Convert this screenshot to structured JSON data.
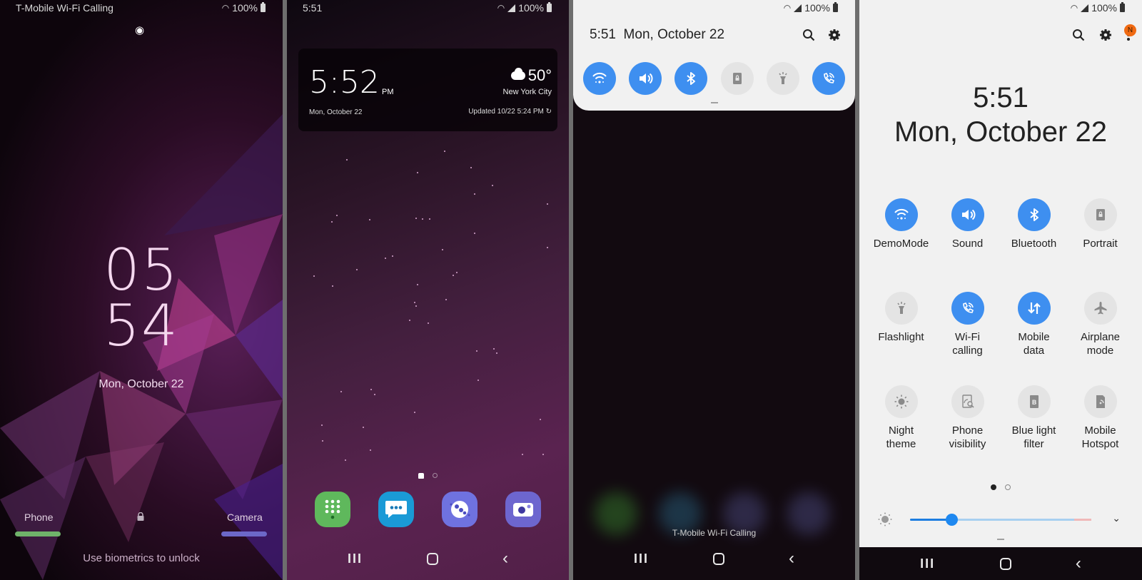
{
  "panel_lockscreen": {
    "status": {
      "carrier": "T-Mobile Wi-Fi Calling",
      "battery": "100%"
    },
    "clock": {
      "hour": "05",
      "minute": "54"
    },
    "date": "Mon, October 22",
    "shortcuts": {
      "left_label": "Phone",
      "right_label": "Camera",
      "left_color": "#6fb36a",
      "right_color": "#6c68c8"
    },
    "hint": "Use biometrics to unlock",
    "icons": {
      "visibility": "eye-icon",
      "lock": "lock-icon"
    }
  },
  "panel_home": {
    "status": {
      "time": "5:51",
      "battery": "100%"
    },
    "widget": {
      "time": "5:52",
      "ampm": "PM",
      "date": "Mon, October 22",
      "temperature": "50°",
      "weather_icon": "cloud-icon",
      "city": "New York City",
      "updated": "Updated 10/22 5:24 PM"
    },
    "page_indicator": {
      "current": 1,
      "total": 2
    },
    "dock": [
      {
        "name": "Phone",
        "icon": "dialpad-icon",
        "color": "#5fb85c"
      },
      {
        "name": "Messages",
        "icon": "message-bubble-icon",
        "color": "#1a9ad6"
      },
      {
        "name": "Samsung Internet",
        "icon": "planet-icon",
        "color": "#6f72e0"
      },
      {
        "name": "Camera",
        "icon": "camera-icon",
        "color": "#6d66cf"
      }
    ]
  },
  "panel_quick_panel": {
    "status": {
      "battery": "100%"
    },
    "header": {
      "time": "5:51",
      "date": "Mon, October 22"
    },
    "tiles": [
      {
        "name": "Wi-Fi",
        "icon": "wifi-icon",
        "on": true
      },
      {
        "name": "Sound",
        "icon": "volume-icon",
        "on": true
      },
      {
        "name": "Bluetooth",
        "icon": "bluetooth-icon",
        "on": true
      },
      {
        "name": "Portrait",
        "icon": "rotation-lock-icon",
        "on": false
      },
      {
        "name": "Flashlight",
        "icon": "flashlight-icon",
        "on": false
      },
      {
        "name": "Wi-Fi calling",
        "icon": "wifi-calling-icon",
        "on": true
      }
    ],
    "carrier": "T-Mobile Wi-Fi Calling"
  },
  "panel_expanded": {
    "status": {
      "battery": "100%"
    },
    "time": "5:51",
    "date": "Mon, October 22",
    "notification_badge": "N",
    "tiles": [
      {
        "label": "DemoMode",
        "icon": "wifi-icon",
        "on": true
      },
      {
        "label": "Sound",
        "icon": "volume-icon",
        "on": true
      },
      {
        "label": "Bluetooth",
        "icon": "bluetooth-icon",
        "on": true
      },
      {
        "label": "Portrait",
        "icon": "rotation-lock-icon",
        "on": false
      },
      {
        "label": "Flashlight",
        "icon": "flashlight-icon",
        "on": false
      },
      {
        "label": "Wi-Fi\ncalling",
        "icon": "wifi-calling-icon",
        "on": true
      },
      {
        "label": "Mobile\ndata",
        "icon": "mobile-data-icon",
        "on": true
      },
      {
        "label": "Airplane\nmode",
        "icon": "airplane-icon",
        "on": false
      },
      {
        "label": "Night\ntheme",
        "icon": "night-theme-icon",
        "on": false
      },
      {
        "label": "Phone\nvisibility",
        "icon": "phone-visibility-icon",
        "on": false
      },
      {
        "label": "Blue light\nfilter",
        "icon": "blue-light-icon",
        "on": false
      },
      {
        "label": "Mobile\nHotspot",
        "icon": "hotspot-icon",
        "on": false
      }
    ],
    "page_indicator": {
      "current": 1,
      "total": 2
    },
    "brightness": {
      "value": 0.23
    }
  },
  "colors": {
    "tile_on": "#3e8ff0",
    "tile_off": "#e4e4e4",
    "slider": "#1e88f0"
  }
}
